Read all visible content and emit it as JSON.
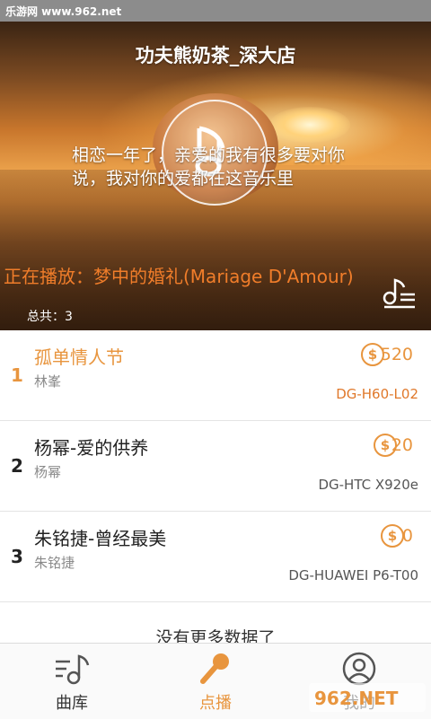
{
  "status": {
    "site": "乐游网 www.962.net"
  },
  "hero": {
    "title": "功夫熊奶茶_深大店",
    "message": "相恋一年了，亲爱的我有很多要对你说，我对你的爱都在这音乐里",
    "now_playing": "正在播放：梦中的婚礼(Mariage D'Amour)",
    "total": "总共：3"
  },
  "songs": [
    {
      "index": "1",
      "title": "孤单情人节",
      "artist": "林峯",
      "amount": "520",
      "device": "DG-H60-L02"
    },
    {
      "index": "2",
      "title": "杨幂-爱的供养",
      "artist": "杨幂",
      "amount": "20",
      "device": "DG-HTC X920e"
    },
    {
      "index": "3",
      "title": "朱铭捷-曾经最美",
      "artist": "朱铭捷",
      "amount": "0",
      "device": "DG-HUAWEI P6-T00"
    }
  ],
  "list_footer": "没有更多数据了",
  "nav": {
    "items": [
      {
        "label": "曲库",
        "icon": "music-library-icon"
      },
      {
        "label": "点播",
        "icon": "microphone-icon"
      },
      {
        "label": "我的",
        "icon": "user-icon"
      }
    ],
    "active": 1
  },
  "watermark": "962.NET 乐游网",
  "colors": {
    "accent": "#e8953e",
    "now_playing": "#f07d2a"
  }
}
